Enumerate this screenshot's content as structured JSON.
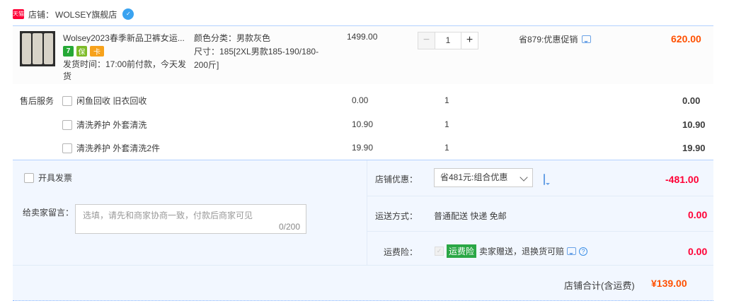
{
  "store": {
    "badge": "天猫",
    "label": "店铺：",
    "name": "WOLSEY旗舰店",
    "vip_icon": "vip-icon"
  },
  "product": {
    "title": "Wolsey2023春季新品卫裤女运...",
    "icons": [
      "7",
      "保",
      "卡"
    ],
    "ship_time": "发货时间：17:00前付款，今天发货",
    "sku_color": "颜色分类：男款灰色",
    "sku_size": "尺寸：185[2XL男款185-190/180-200斤]",
    "price": "1499.00",
    "qty": "1",
    "qty_minus": "−",
    "qty_plus": "+",
    "promo": "省879:优惠促销",
    "total": "620.00"
  },
  "services": {
    "title": "售后服务",
    "items": [
      {
        "name": "闲鱼回收 旧衣回收",
        "price": "0.00",
        "qty": "1",
        "sum": "0.00"
      },
      {
        "name": "清洗养护 外套清洗",
        "price": "10.90",
        "qty": "1",
        "sum": "10.90"
      },
      {
        "name": "清洗养护 外套清洗2件",
        "price": "19.90",
        "qty": "1",
        "sum": "19.90"
      }
    ]
  },
  "order": {
    "invoice_label": "开具发票",
    "message_label": "给卖家留言：",
    "message_placeholder": "选填，请先和商家协商一致，付款后商家可见",
    "message_count": "0/200",
    "discount_label": "店铺优惠：",
    "discount_selected": "省481元:组合优惠",
    "discount_value": "-481.00",
    "shipping_label": "运送方式：",
    "shipping_value_text": "普通配送 快递 免邮",
    "shipping_value": "0.00",
    "insurance_label": "运费险：",
    "insurance_tag": "运费险",
    "insurance_text": "卖家赠送，退换货可赔",
    "insurance_value": "0.00",
    "total_label": "店铺合计(含运费)",
    "total_value": "¥139.00"
  },
  "colors": {
    "accent_orange": "#ff5000",
    "accent_red": "#ff0036",
    "panel_bg": "#f2f7ff",
    "tag_green": "#2aa745"
  }
}
